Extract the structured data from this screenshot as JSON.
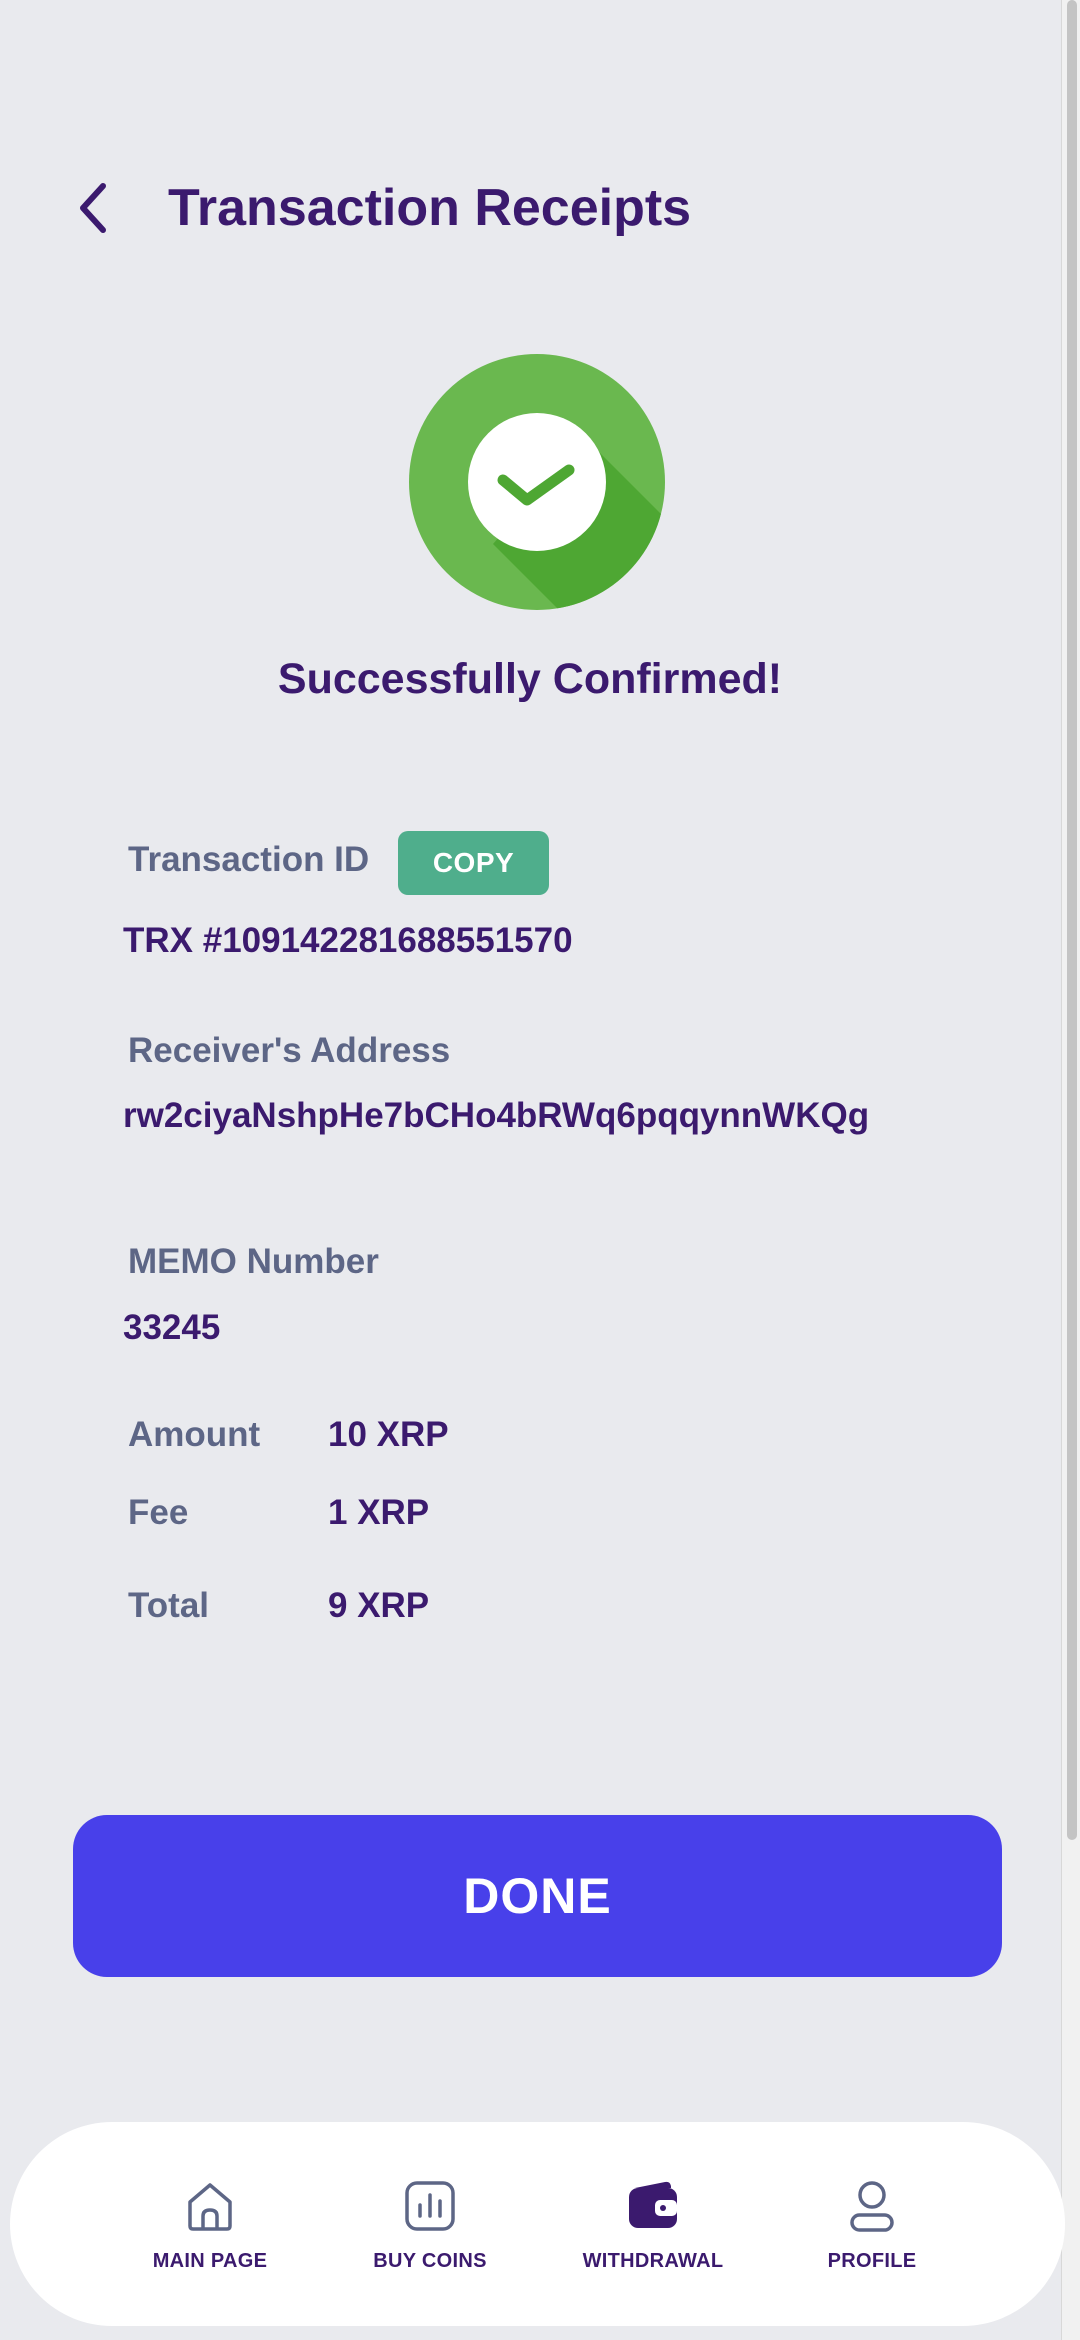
{
  "header": {
    "title": "Transaction Receipts",
    "back_icon": "chevron-left-icon"
  },
  "status": {
    "icon": "check-circle-icon",
    "message": "Successfully Confirmed!",
    "colors": {
      "circle": "#6ab84f",
      "shadow": "#4ea733",
      "check": "#4ea733"
    }
  },
  "details": {
    "transaction_id_label": "Transaction ID",
    "copy_label": "COPY",
    "transaction_id": "TRX #109142281688551570",
    "receiver_label": "Receiver's Address",
    "receiver_address": "rw2ciyaNshpHe7bCHo4bRWq6pqqynnWKQg",
    "memo_label": "MEMO Number",
    "memo_number": "33245"
  },
  "summary": {
    "amount_label": "Amount",
    "amount_value": "10 XRP",
    "fee_label": "Fee",
    "fee_value": "1 XRP",
    "total_label": "Total",
    "total_value": "9 XRP"
  },
  "actions": {
    "done_label": "DONE"
  },
  "nav": {
    "items": [
      {
        "label": "MAIN PAGE",
        "icon": "home-icon"
      },
      {
        "label": "BUY COINS",
        "icon": "chart-icon"
      },
      {
        "label": "WITHDRAWAL",
        "icon": "wallet-icon",
        "active": true
      },
      {
        "label": "PROFILE",
        "icon": "user-icon"
      }
    ]
  },
  "colors": {
    "background": "#e9eaee",
    "primary_text": "#3b1a6e",
    "secondary_text": "#5d6686",
    "copy_button": "#4fae8c",
    "done_button": "#4840ea"
  }
}
